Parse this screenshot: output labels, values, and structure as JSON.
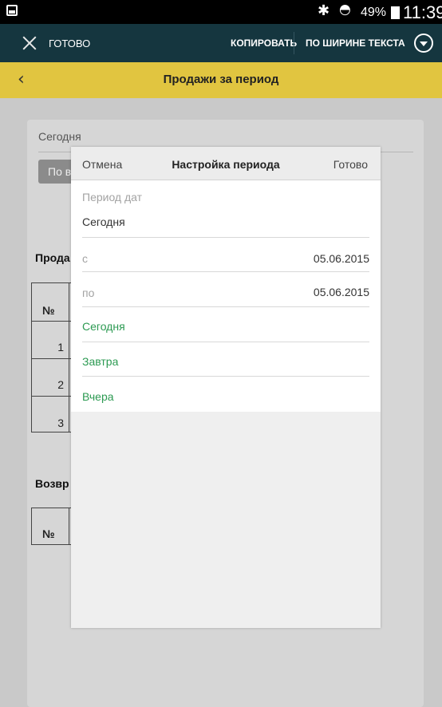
{
  "status_bar": {
    "bluetooth_icon": "bluetooth-icon",
    "wifi_icon": "wifi-icon",
    "battery_percent": "49%",
    "time": "11:39"
  },
  "action_bar": {
    "done_label": "ГОТОВО",
    "copy_label": "КОПИРОВАТЬ",
    "fit_text_label": "ПО ШИРИНЕ ТЕКСТА"
  },
  "title_bar": {
    "title": "Продажи за период"
  },
  "background": {
    "period_value": "Сегодня",
    "button_label_partial": "По в",
    "sales_heading_partial": "Прода",
    "returns_heading_partial": "Возвр",
    "table_no_header": "№",
    "row_numbers": [
      "1",
      "2",
      "3"
    ]
  },
  "dialog": {
    "cancel_label": "Отмена",
    "title": "Настройка периода",
    "done_label": "Готово",
    "period_label": "Период дат",
    "period_value": "Сегодня",
    "from_label": "с",
    "from_value": "05.06.2015",
    "to_label": "по",
    "to_value": "05.06.2015",
    "presets": [
      "Сегодня",
      "Завтра",
      "Вчера"
    ]
  },
  "colors": {
    "action_bar": "#15363f",
    "title_bar": "#e1c540",
    "preset_green": "#2c9a52"
  }
}
